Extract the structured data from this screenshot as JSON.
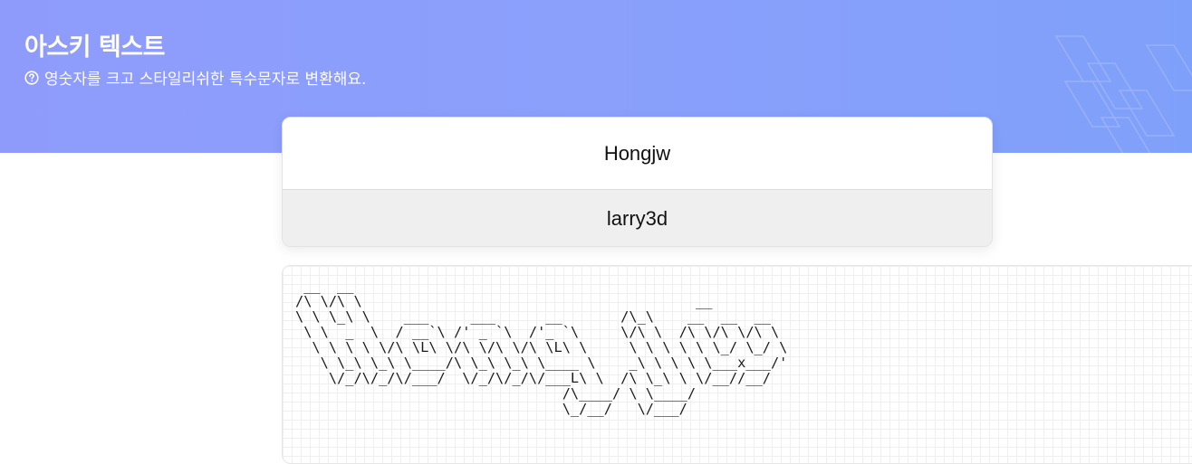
{
  "header": {
    "title": "아스키 텍스트",
    "subtitle": "영숫자를 크고 스타일리쉬한 특수문자로 변환해요.",
    "help_icon": "question-circle-icon"
  },
  "input": {
    "value": "Hongjw"
  },
  "font_select": {
    "selected": "larry3d"
  },
  "output": {
    "ascii_art": " __  __\n/\\ \\/\\ \\                                        __\n\\ \\ \\_\\ \\    ___     ___      __       /\\_\\    __  __  __\n \\ \\  _  \\  / __`\\ /' _ `\\  /'_ `\\     \\/\\ \\  /\\ \\/\\ \\/\\ \\\n  \\ \\ \\ \\ \\/\\ \\L\\ \\/\\ \\/\\ \\/\\ \\L\\ \\     \\ \\ \\ \\ \\ \\_/ \\_/ \\\n   \\ \\_\\ \\_\\ \\____/\\ \\_\\ \\_\\ \\____ \\    _\\ \\ \\ \\ \\___x___/'\n    \\/_/\\/_/\\/___/  \\/_/\\/_/\\/___L\\ \\  /\\ \\_\\ \\ \\/__//__/\n                                /\\____/ \\ \\____/\n                                \\_/__/   \\/___/"
  },
  "colors": {
    "hero_gradient_start": "#8f9bfb",
    "hero_gradient_end": "#7fa0fa",
    "hero_text": "#ffffff",
    "select_background": "#efefef"
  }
}
